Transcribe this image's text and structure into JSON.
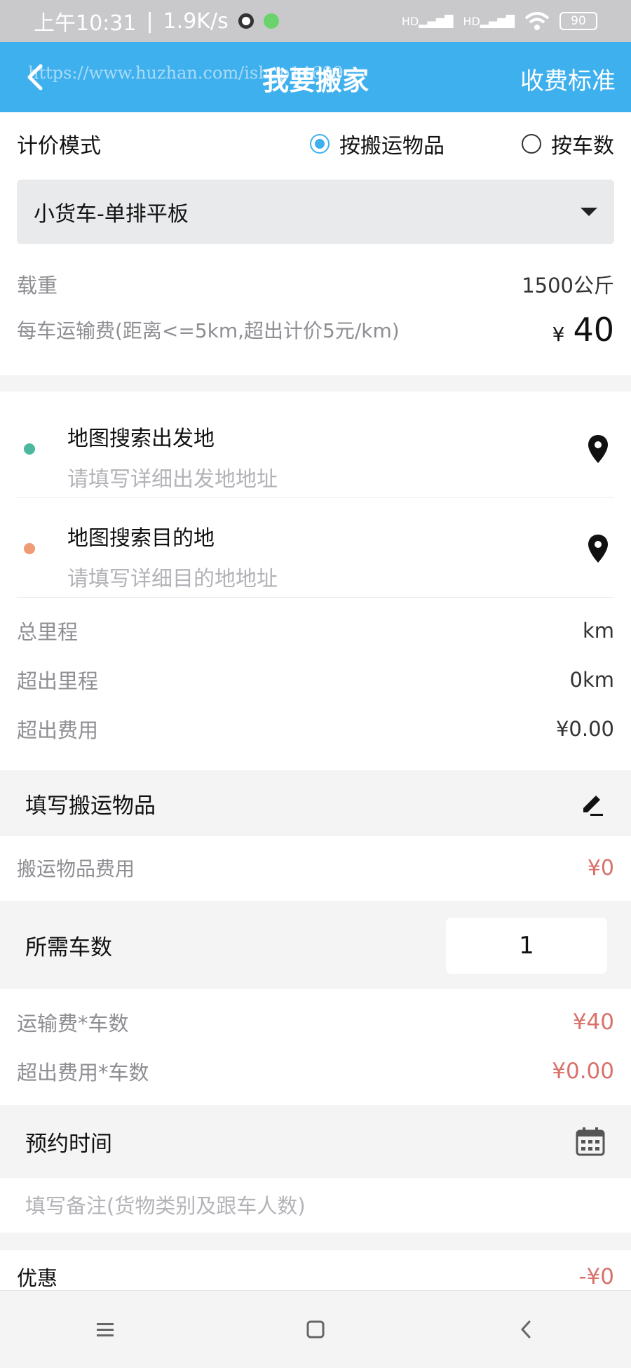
{
  "status_bar": {
    "time": "上午10:31",
    "speed": "1.9K/s",
    "signal1": "HD",
    "signal2": "HD",
    "battery": "90"
  },
  "header": {
    "title": "我要搬家",
    "action": "收费标准",
    "watermark": "https://www.huzhan.com/ishop14609"
  },
  "pricing": {
    "label": "计价模式",
    "option_items": "按搬运物品",
    "option_trucks": "按车数",
    "selected": "按搬运物品",
    "truck_type": "小货车-单排平板",
    "load_label": "载重",
    "load_value": "1500公斤",
    "fee_label": "每车运输费(距离<=5km,超出计价5元/km)",
    "fee_currency": "¥",
    "fee_value": "40"
  },
  "addresses": {
    "origin_title": "地图搜索出发地",
    "origin_placeholder": "请填写详细出发地地址",
    "dest_title": "地图搜索目的地",
    "dest_placeholder": "请填写详细目的地地址"
  },
  "mileage": {
    "total_label": "总里程",
    "total_value": "km",
    "extra_label": "超出里程",
    "extra_value": "0km",
    "extra_fee_label": "超出费用",
    "extra_fee_value": "¥0.00"
  },
  "items": {
    "header": "填写搬运物品",
    "fee_label": "搬运物品费用",
    "fee_value": "¥0"
  },
  "trucks": {
    "label": "所需车数",
    "value": "1",
    "transport_label": "运输费*车数",
    "transport_value": "¥40",
    "extra_label": "超出费用*车数",
    "extra_value": "¥0.00"
  },
  "booking": {
    "label": "预约时间",
    "notes_placeholder": "填写备注(货物类别及跟车人数)"
  },
  "discount": {
    "label": "优惠",
    "value": "-¥0"
  },
  "colors": {
    "primary": "#3fb0ee",
    "origin_dot": "#4bb89f",
    "dest_dot": "#ef9b73",
    "price_red": "#d9716a"
  }
}
